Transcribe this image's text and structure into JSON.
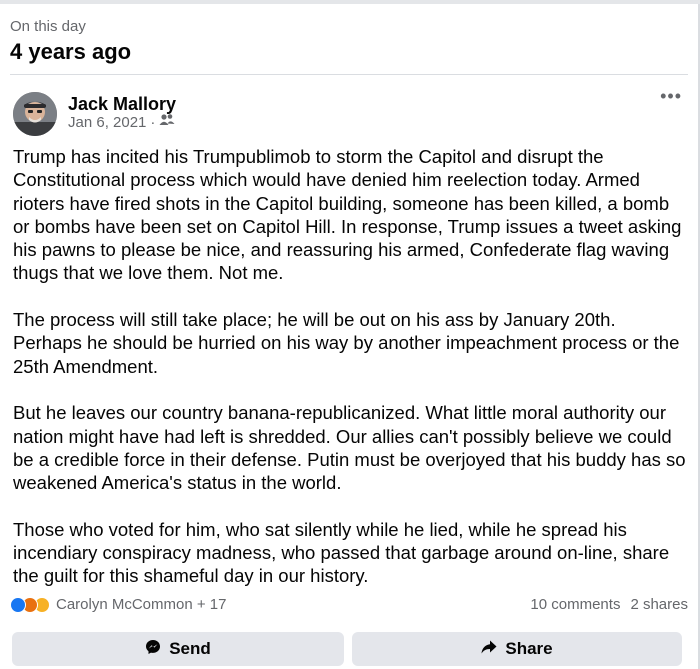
{
  "memory": {
    "label": "On this day",
    "title": "4 years ago"
  },
  "post": {
    "author": "Jack Mallory",
    "date": "Jan 6, 2021",
    "separator": "·",
    "audience_icon": "friends-icon",
    "more_icon": "more-options-icon",
    "more_text": "•••",
    "paragraphs": [
      "Trump has incited his Trumpublimob to storm the Capitol and disrupt the Constitutional process which would have denied him reelection today. Armed rioters have fired shots in the Capitol building, someone has been killed, a bomb or bombs have been set on Capitol Hill. In response, Trump issues a tweet  asking his pawns to please be nice, and reassuring his armed, Confederate flag waving thugs that we love them. Not me.",
      "The process will still take place; he will be out on his ass by January 20th. Perhaps he should be hurried on his way by another impeachment process or the 25th Amendment.",
      "But he leaves our country banana-republicanized. What little moral authority our nation might have had left is shredded. Our allies can't possibly believe we could be a credible force in their defense. Putin must be overjoyed that his buddy has so weakened America's status in the world.",
      "Those who voted for him, who sat silently while he lied, while he spread his incendiary conspiracy madness, who passed that garbage around on-line, share the guilt for this shameful day in our history."
    ]
  },
  "reactions": {
    "icons": [
      "like-reaction-icon",
      "angry-reaction-icon",
      "sad-reaction-icon"
    ],
    "summary": "Carolyn McCommon + 17",
    "comments": "10 comments",
    "shares": "2 shares"
  },
  "actions": {
    "send_label": "Send",
    "send_icon": "messenger-icon",
    "share_label": "Share",
    "share_icon": "share-arrow-icon"
  },
  "colors": {
    "like": "#1877f2",
    "angry": "#e9710f",
    "sad": "#f7b125",
    "secondary_text": "#65676b",
    "button_bg": "#e4e6eb"
  }
}
